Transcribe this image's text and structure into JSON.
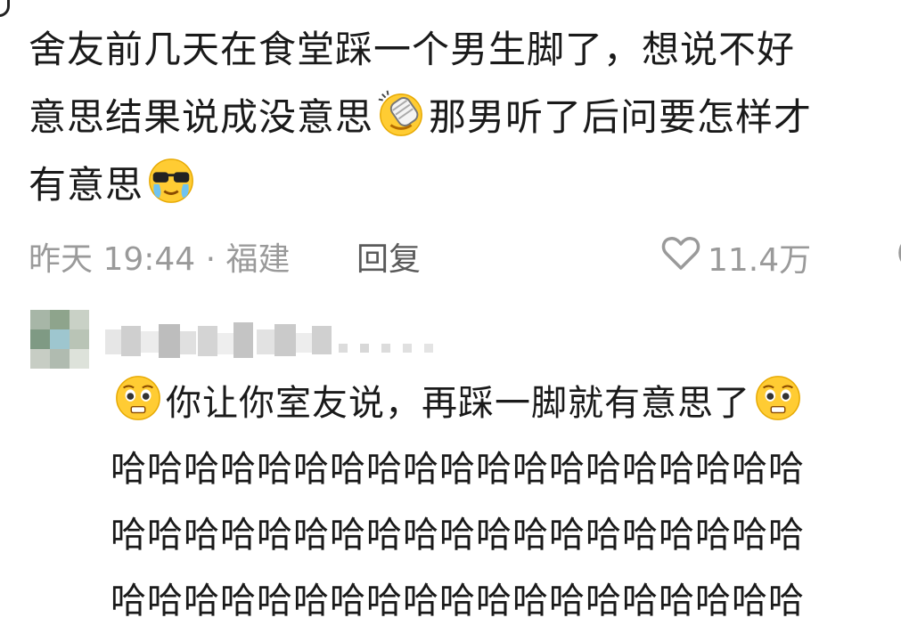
{
  "post": {
    "line1": "舍友前几天在食堂踩一个男生脚了，想说不好",
    "line2_part1": "意思结果说成没意思",
    "line2_part2": "那男听了后问要怎样才",
    "line3": "有意思"
  },
  "meta": {
    "time_location": "昨天 19:44 · 福建",
    "reply_label": "回复",
    "like_count": "11.4万"
  },
  "comment": {
    "text": "你让你室友说，再踩一脚就有意思了",
    "laugh_line1": "哈哈哈哈哈哈哈哈哈哈哈哈哈哈哈哈哈哈哈",
    "laugh_line2": "哈哈哈哈哈哈哈哈哈哈哈哈哈哈哈哈哈哈哈",
    "laugh_line3": "哈哈哈哈哈哈哈哈哈哈哈哈哈哈哈哈哈哈哈"
  },
  "icons": {
    "emoji_1": "facepalm-emoji",
    "emoji_2": "sunglasses-tears-emoji",
    "emoji_3": "pleading-emoji",
    "like": "heart-icon"
  }
}
